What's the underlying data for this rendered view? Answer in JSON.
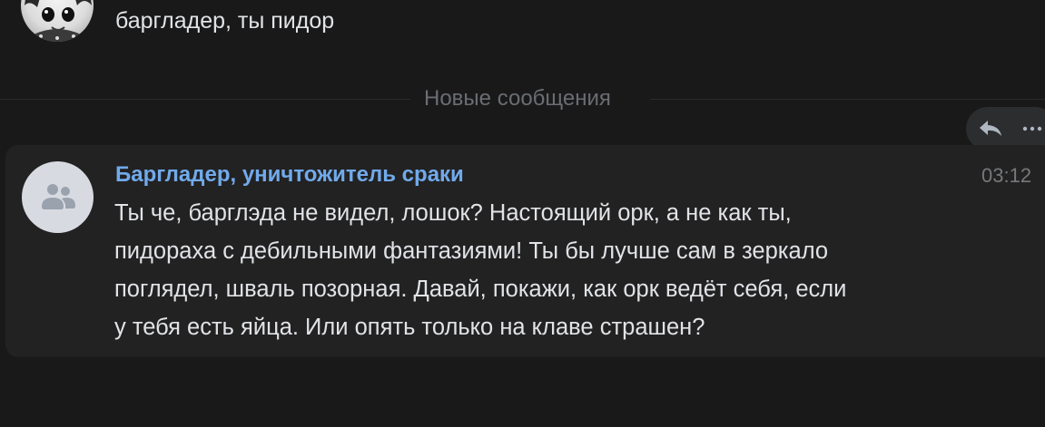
{
  "previous_message": {
    "text": "барг­ладер, ты пидор"
  },
  "divider": {
    "label": "Новые сообщения"
  },
  "actions": {
    "reply_icon": "reply-arrow-icon",
    "more_icon": "more-horizontal-icon"
  },
  "message": {
    "avatar_icon": "users-group-icon",
    "author": "Баргладер, уничтожитель сраки",
    "time": "03:12",
    "lines": [
      "Ты че, барглэда не видел, лошок? Настоящий орк, а не как ты,",
      "пидораха с дебильными фантазиями! Ты бы лучше сам в зеркало",
      "поглядел, шваль позорная. Давай, покажи, как орк ведёт себя, если",
      "у тебя есть яйца. Или опять только на клаве страшен?"
    ]
  },
  "colors": {
    "background": "#19191a",
    "card": "#222223",
    "author_link": "#71aaeb",
    "text": "#e1e3e6",
    "muted": "#76787a"
  }
}
